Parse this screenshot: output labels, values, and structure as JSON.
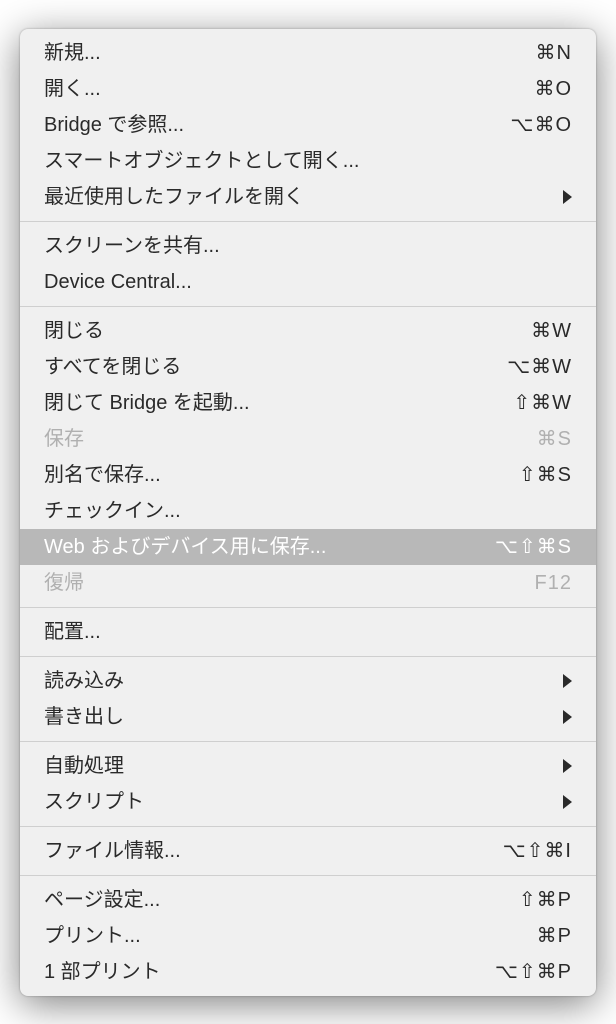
{
  "menu": {
    "groups": [
      [
        {
          "id": "new",
          "label": "新規...",
          "shortcut": "⌘N"
        },
        {
          "id": "open",
          "label": "開く...",
          "shortcut": "⌘O"
        },
        {
          "id": "browse-bridge",
          "label": "Bridge で参照...",
          "shortcut": "⌥⌘O"
        },
        {
          "id": "open-as-smart",
          "label": "スマートオブジェクトとして開く..."
        },
        {
          "id": "open-recent",
          "label": "最近使用したファイルを開く",
          "submenu": true
        }
      ],
      [
        {
          "id": "share-screen",
          "label": "スクリーンを共有..."
        },
        {
          "id": "device-central",
          "label": "Device Central..."
        }
      ],
      [
        {
          "id": "close",
          "label": "閉じる",
          "shortcut": "⌘W"
        },
        {
          "id": "close-all",
          "label": "すべてを閉じる",
          "shortcut": "⌥⌘W"
        },
        {
          "id": "close-go-bridge",
          "label": "閉じて Bridge を起動...",
          "shortcut": "⇧⌘W"
        },
        {
          "id": "save",
          "label": "保存",
          "shortcut": "⌘S",
          "disabled": true
        },
        {
          "id": "save-as",
          "label": "別名で保存...",
          "shortcut": "⇧⌘S"
        },
        {
          "id": "check-in",
          "label": "チェックイン..."
        },
        {
          "id": "save-for-web",
          "label": "Web およびデバイス用に保存...",
          "shortcut": "⌥⇧⌘S",
          "highlighted": true
        },
        {
          "id": "revert",
          "label": "復帰",
          "shortcut": "F12",
          "disabled": true
        }
      ],
      [
        {
          "id": "place",
          "label": "配置..."
        }
      ],
      [
        {
          "id": "import",
          "label": "読み込み",
          "submenu": true
        },
        {
          "id": "export",
          "label": "書き出し",
          "submenu": true
        }
      ],
      [
        {
          "id": "automate",
          "label": "自動処理",
          "submenu": true
        },
        {
          "id": "scripts",
          "label": "スクリプト",
          "submenu": true
        }
      ],
      [
        {
          "id": "file-info",
          "label": "ファイル情報...",
          "shortcut": "⌥⇧⌘I"
        }
      ],
      [
        {
          "id": "page-setup",
          "label": "ページ設定...",
          "shortcut": "⇧⌘P"
        },
        {
          "id": "print",
          "label": "プリント...",
          "shortcut": "⌘P"
        },
        {
          "id": "print-one",
          "label": "1 部プリント",
          "shortcut": "⌥⇧⌘P"
        }
      ]
    ]
  }
}
